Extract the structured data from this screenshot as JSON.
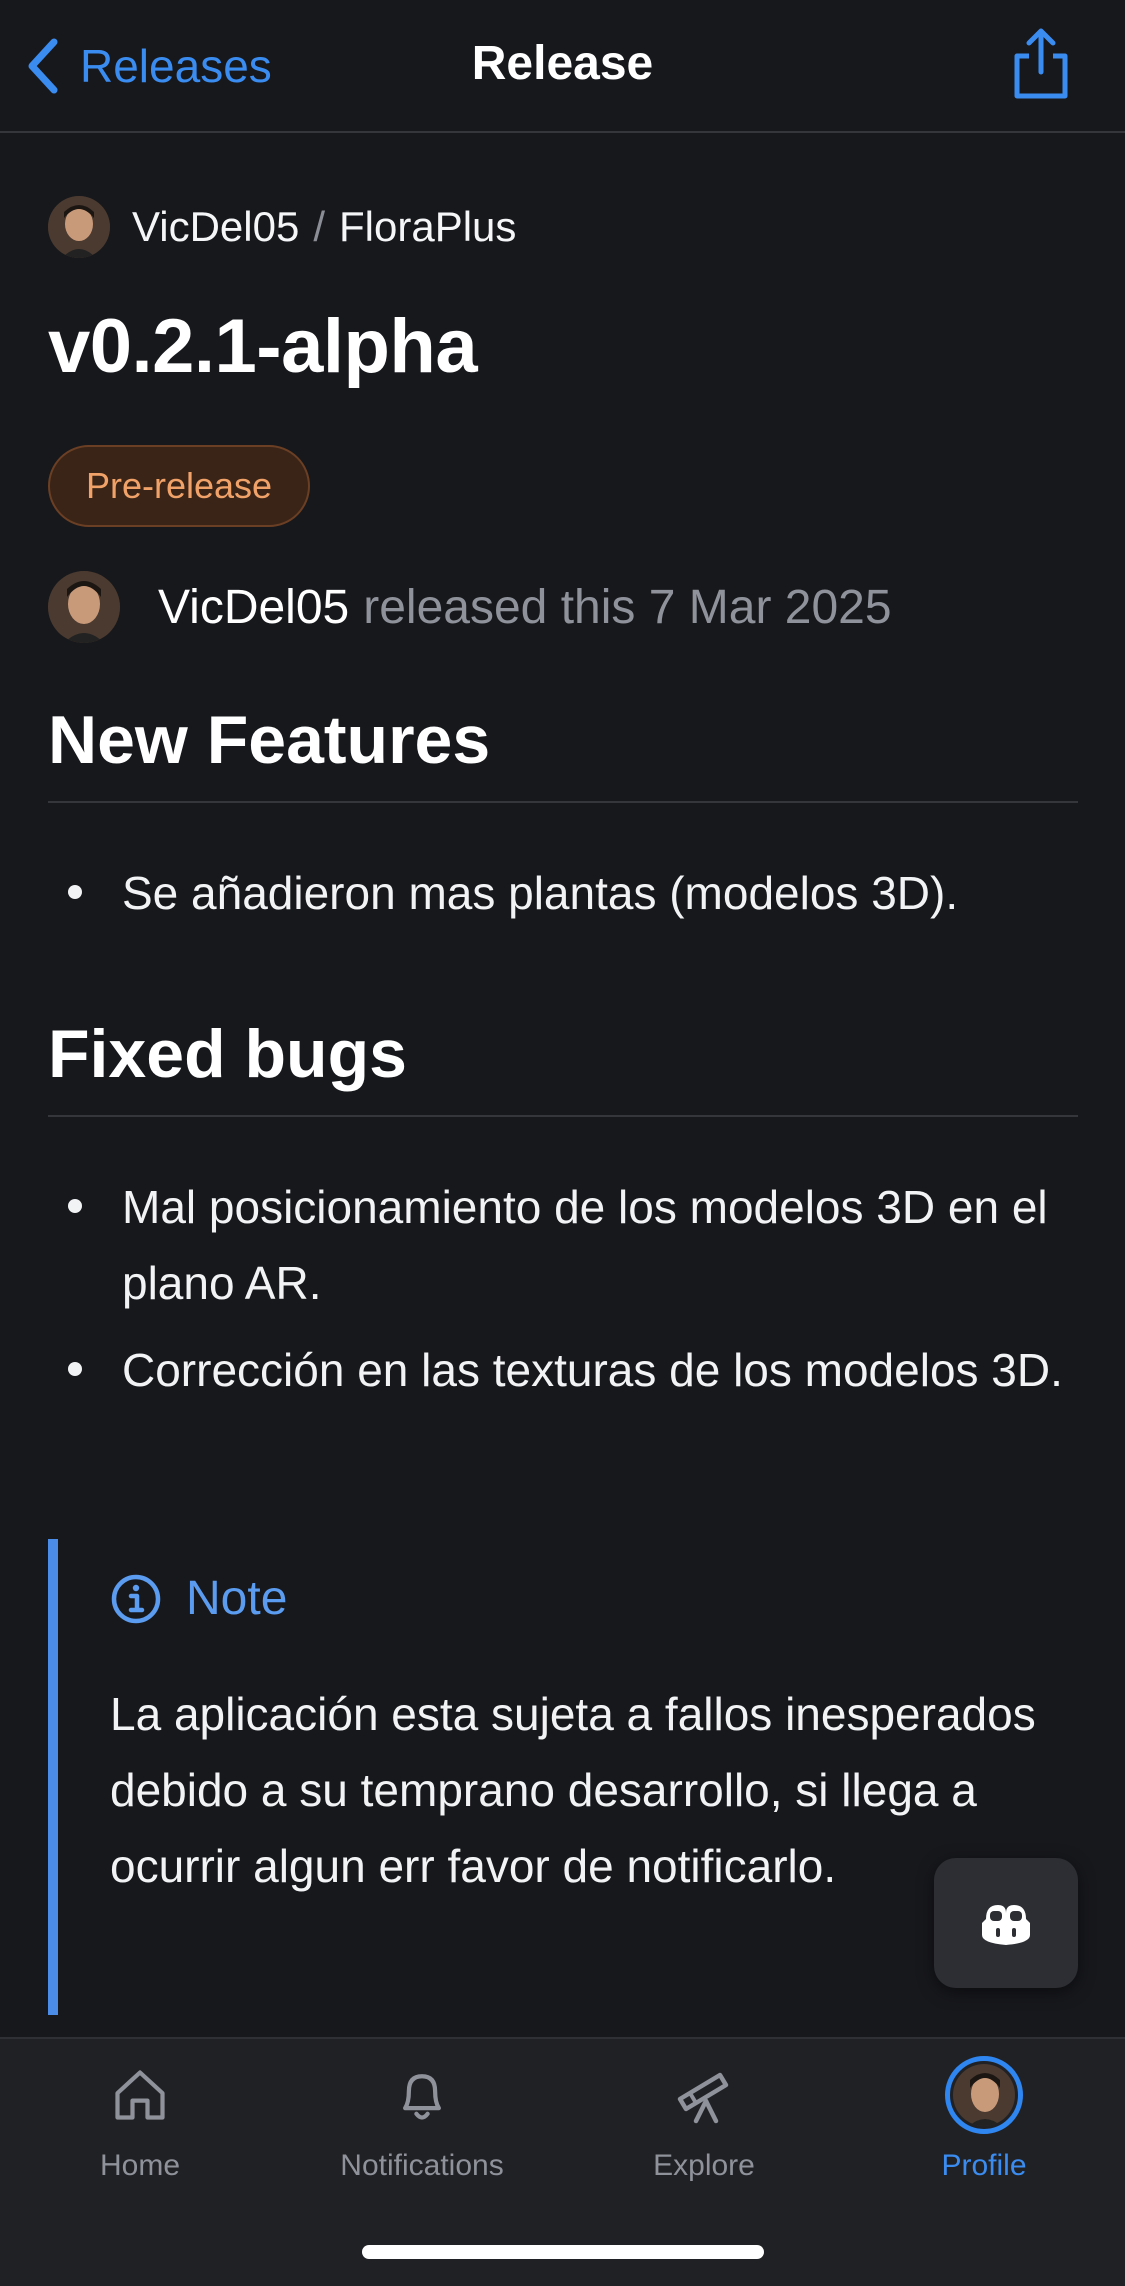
{
  "nav": {
    "back_label": "Releases",
    "title": "Release"
  },
  "repo": {
    "owner": "VicDel05",
    "separator": "/",
    "name": "FloraPlus"
  },
  "release": {
    "tag": "v0.2.1-alpha",
    "badge": "Pre-release",
    "author": "VicDel05",
    "released_text": "released this 7 Mar 2025"
  },
  "sections": {
    "features": {
      "heading": "New Features",
      "items": [
        "Se añadieron mas plantas (modelos 3D)."
      ]
    },
    "bugs": {
      "heading": "Fixed bugs",
      "items": [
        "Mal posicionamiento de los modelos 3D en el plano AR.",
        "Corrección en las texturas de los modelos 3D."
      ]
    }
  },
  "note": {
    "label": "Note",
    "text": "La aplicación esta sujeta a fallos inesperados debido a su temprano desarrollo, si llega a ocurrir algun err favor de notificarlo."
  },
  "tabs": {
    "home": "Home",
    "notifications": "Notifications",
    "explore": "Explore",
    "profile": "Profile",
    "active": "profile"
  },
  "colors": {
    "background": "#17181c",
    "accent": "#3b8cf0",
    "badge_text": "#f0a268",
    "badge_bg": "#3a2417",
    "note_border": "#4a8ce8",
    "muted_text": "#8f929a"
  },
  "icons": {
    "back": "chevron-left-icon",
    "share": "share-icon",
    "note": "info-icon",
    "copilot": "copilot-icon",
    "home": "home-icon",
    "notifications": "bell-icon",
    "explore": "telescope-icon"
  }
}
